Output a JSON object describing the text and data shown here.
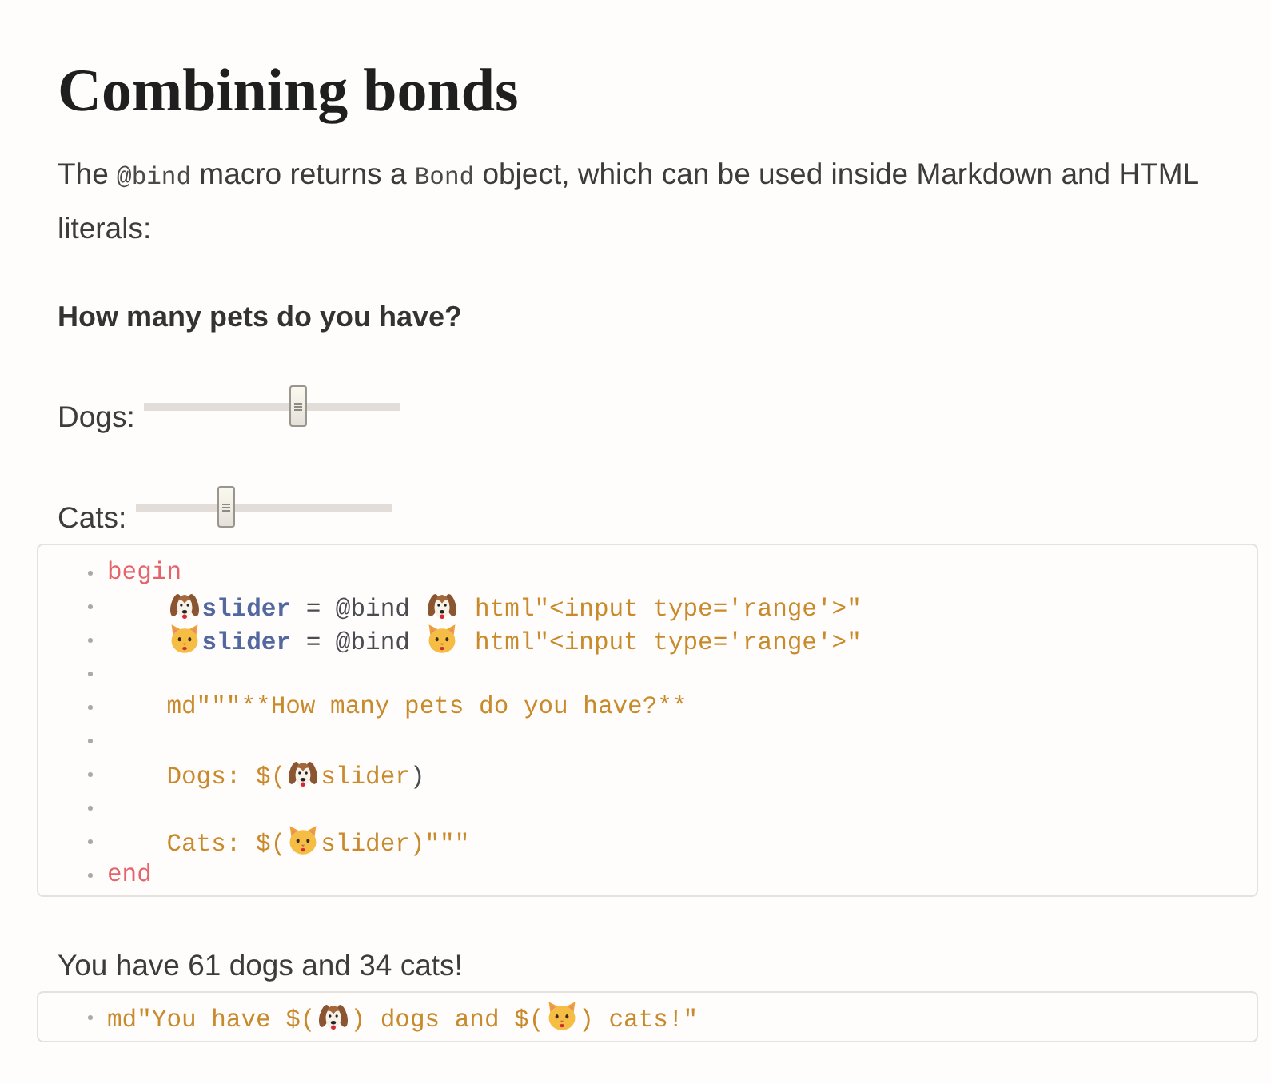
{
  "markdown": {
    "heading": "Combining bonds",
    "intro": [
      {
        "kind": "text",
        "text": "The "
      },
      {
        "kind": "code",
        "text": "@bind"
      },
      {
        "kind": "text",
        "text": " macro returns a "
      },
      {
        "kind": "code",
        "text": "Bond"
      },
      {
        "kind": "text",
        "text": " object, which can be used inside Markdown and HTML literals:"
      }
    ]
  },
  "cells": [
    {
      "output": {
        "kind": "form",
        "question": "How many pets do you have?",
        "sliders": [
          {
            "label": "Dogs:",
            "level": 0.61
          },
          {
            "label": "Cats:",
            "level": 0.34
          }
        ]
      },
      "code": [
        {
          "kind": "code",
          "indented": false,
          "tokens": [
            {
              "kind": "keyword",
              "text": "begin"
            }
          ]
        },
        {
          "kind": "code",
          "indented": true,
          "tokens": [
            {
              "kind": "dog"
            },
            {
              "kind": "variable",
              "text": "slider"
            },
            {
              "kind": "plain",
              "text": " = @bind "
            },
            {
              "kind": "dog"
            },
            {
              "kind": "string",
              "text": " html\"<input type='range'>\""
            }
          ]
        },
        {
          "kind": "code",
          "indented": true,
          "tokens": [
            {
              "kind": "cat"
            },
            {
              "kind": "variable",
              "text": "slider"
            },
            {
              "kind": "plain",
              "text": " = @bind "
            },
            {
              "kind": "cat"
            },
            {
              "kind": "string",
              "text": " html\"<input type='range'>\""
            }
          ]
        },
        {
          "kind": "blank"
        },
        {
          "kind": "code",
          "indented": true,
          "tokens": [
            {
              "kind": "string",
              "text": "md\"\"\"**How many pets do you have?**"
            }
          ]
        },
        {
          "kind": "blank"
        },
        {
          "kind": "code",
          "indented": true,
          "tokens": [
            {
              "kind": "string",
              "text": "Dogs: $("
            },
            {
              "kind": "dog"
            },
            {
              "kind": "string",
              "text": "slider"
            },
            {
              "kind": "plain",
              "text": ")"
            }
          ]
        },
        {
          "kind": "blank"
        },
        {
          "kind": "code",
          "indented": true,
          "tokens": [
            {
              "kind": "string",
              "text": "Cats: $("
            },
            {
              "kind": "cat"
            },
            {
              "kind": "string",
              "text": "slider)\"\"\""
            }
          ]
        },
        {
          "kind": "code",
          "indented": false,
          "tokens": [
            {
              "kind": "keyword",
              "text": "end"
            }
          ]
        }
      ]
    },
    {
      "output": {
        "kind": "text",
        "text": "You have 61 dogs and 34 cats!"
      },
      "code": [
        {
          "kind": "code",
          "indented": false,
          "tokens": [
            {
              "kind": "string",
              "text": "md\"You have $("
            },
            {
              "kind": "dog"
            },
            {
              "kind": "string",
              "text": ") dogs and $("
            },
            {
              "kind": "cat"
            },
            {
              "kind": "string",
              "text": ") cats!\""
            }
          ]
        }
      ]
    }
  ]
}
